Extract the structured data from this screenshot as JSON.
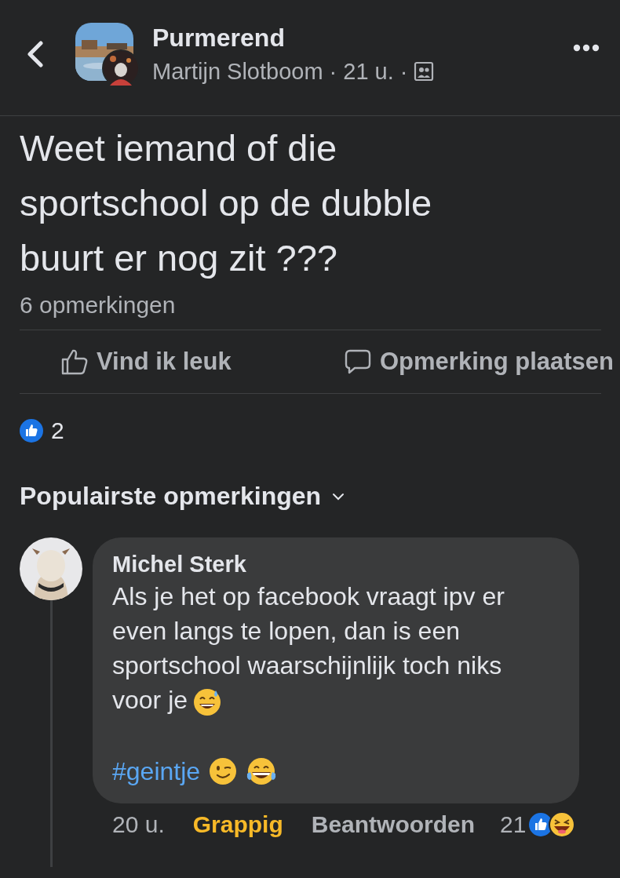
{
  "header": {
    "group": "Purmerend",
    "author": "Martijn Slotboom",
    "time": "21 u.",
    "separator": "·"
  },
  "post": {
    "text": "Weet iemand of die sportschool op de dubble buurt er nog zit ???",
    "comment_count": "6 opmerkingen"
  },
  "actions": [
    {
      "kind": "like",
      "label": "Vind ik leuk"
    },
    {
      "kind": "comment",
      "label": "Opmerking plaatsen"
    }
  ],
  "reactions": {
    "count": "2"
  },
  "comments_heading": "Populairste opmerkingen",
  "comments": [
    {
      "author": "Michel Sterk",
      "text": "Als je het op facebook vraagt ipv er even langs te lopen, dan is een sportschool waarschijnlijk toch niks",
      "text_end": "voor je",
      "hashtag": "#geintje",
      "time": "20 u.",
      "reaction": {
        "label": "Grappig",
        "selected": true
      },
      "reply": "Beantwoorden",
      "reaction_count": "21"
    }
  ]
}
